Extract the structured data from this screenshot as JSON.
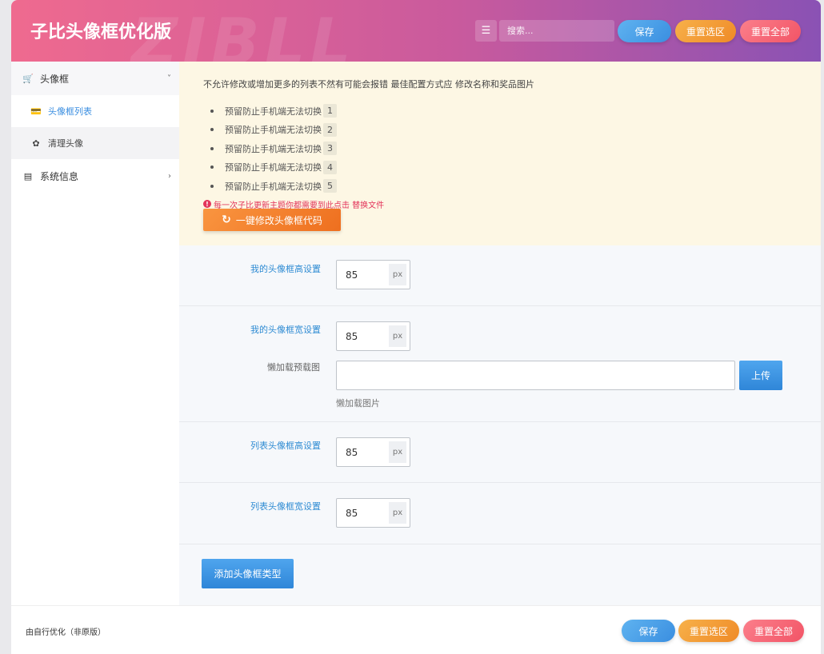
{
  "header": {
    "title": "子比头像框优化版",
    "watermark": "ZIBLL",
    "search_placeholder": "搜索...",
    "save_label": "保存",
    "reset_section_label": "重置选区",
    "reset_all_label": "重置全部"
  },
  "sidebar": {
    "items": [
      {
        "label": "头像框",
        "icon": "cart-icon"
      },
      {
        "label": "头像框列表",
        "icon": "id-card-icon"
      },
      {
        "label": "清理头像",
        "icon": "broom-icon"
      },
      {
        "label": "系统信息",
        "icon": "bank-icon"
      }
    ]
  },
  "notice": {
    "text": "不允许修改或增加更多的列表不然有可能会报错 最佳配置方式应 修改名称和奖品图片",
    "list_text": "预留防止手机端无法切换",
    "list_numbers": [
      "1",
      "2",
      "3",
      "4",
      "5"
    ],
    "warning": "每一次子比更新主题你都需要到此点击 替换文件",
    "button_label": "一键修改头像框代码"
  },
  "fields": {
    "my_height_label": "我的头像框高设置",
    "my_height_value": "85",
    "my_width_label": "我的头像框宽设置",
    "my_width_value": "85",
    "lazy_label": "懒加载预载图",
    "lazy_value": "",
    "upload_label": "上传",
    "lazy_helper": "懒加载图片",
    "list_height_label": "列表头像框高设置",
    "list_height_value": "85",
    "list_width_label": "列表头像框宽设置",
    "list_width_value": "85",
    "unit": "px",
    "add_type_label": "添加头像框类型"
  },
  "footer": {
    "text": "由自行优化（非原版）",
    "save_label": "保存",
    "reset_section_label": "重置选区",
    "reset_all_label": "重置全部"
  }
}
